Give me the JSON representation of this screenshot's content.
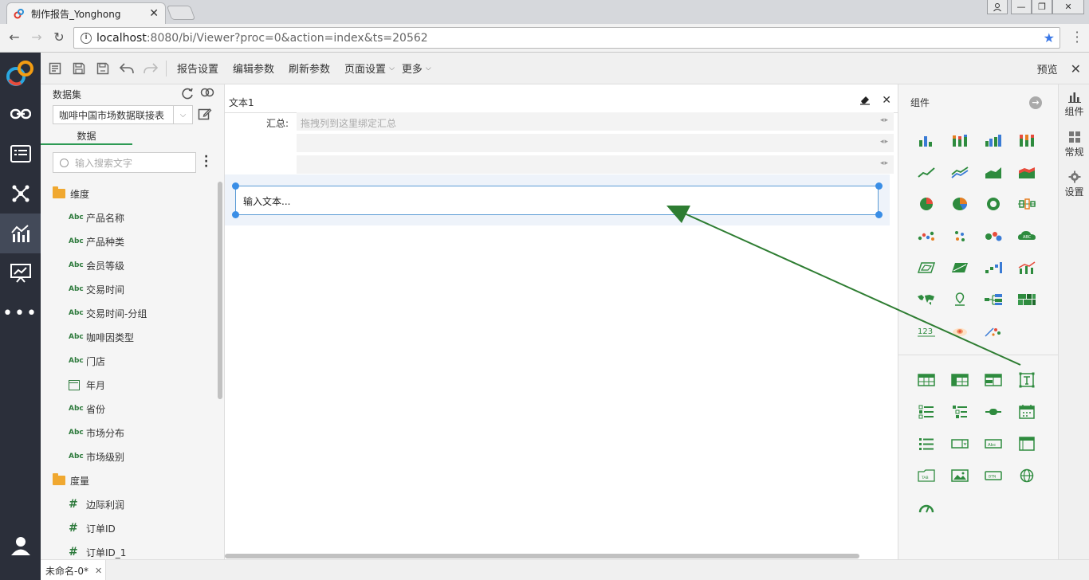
{
  "browser": {
    "tab_title": "制作报告_Yonghong",
    "url_host": "localhost",
    "url_path": ":8080/bi/Viewer?proc=0&action=index&ts=20562"
  },
  "toolbar": {
    "report_settings": "报告设置",
    "edit_params": "编辑参数",
    "refresh_params": "刷新参数",
    "page_settings": "页面设置",
    "more": "更多",
    "preview": "预览"
  },
  "datapanel": {
    "title": "数据集",
    "dataset_value": "咖啡中国市场数据联接表",
    "tab_label": "数据",
    "search_placeholder": "输入搜索文字",
    "dimension_folder": "维度",
    "measure_folder": "度量",
    "dimensions": [
      {
        "type": "abc",
        "label": "产品名称"
      },
      {
        "type": "abc",
        "label": "产品种类"
      },
      {
        "type": "abc",
        "label": "会员等级"
      },
      {
        "type": "abc",
        "label": "交易时间"
      },
      {
        "type": "abc",
        "label": "交易时间-分组"
      },
      {
        "type": "abc",
        "label": "咖啡因类型"
      },
      {
        "type": "abc",
        "label": "门店"
      },
      {
        "type": "date",
        "label": "年月"
      },
      {
        "type": "abc",
        "label": "省份"
      },
      {
        "type": "abc",
        "label": "市场分布"
      },
      {
        "type": "abc",
        "label": "市场级别"
      }
    ],
    "measures": [
      {
        "type": "num",
        "label": "边际利润"
      },
      {
        "type": "num",
        "label": "订单ID"
      },
      {
        "type": "num",
        "label": "订单ID_1"
      }
    ],
    "abc_badge": "Abc",
    "num_badge": "#"
  },
  "canvas": {
    "component_title": "文本1",
    "summary_label": "汇总:",
    "summary_placeholder": "拖拽列到这里绑定汇总",
    "text_placeholder": "输入文本..."
  },
  "components_panel": {
    "title": "组件"
  },
  "side_tabs": {
    "components": "组件",
    "general": "常规",
    "settings": "设置"
  },
  "bottom": {
    "report_tab": "未命名-0*"
  },
  "colors": {
    "accent_green": "#2d9a54",
    "icon_green": "#2e8b3e",
    "selection_blue": "#3a8ee6",
    "nav_dark": "#2b2f3a",
    "annotation_arrow": "#2e7d32"
  }
}
